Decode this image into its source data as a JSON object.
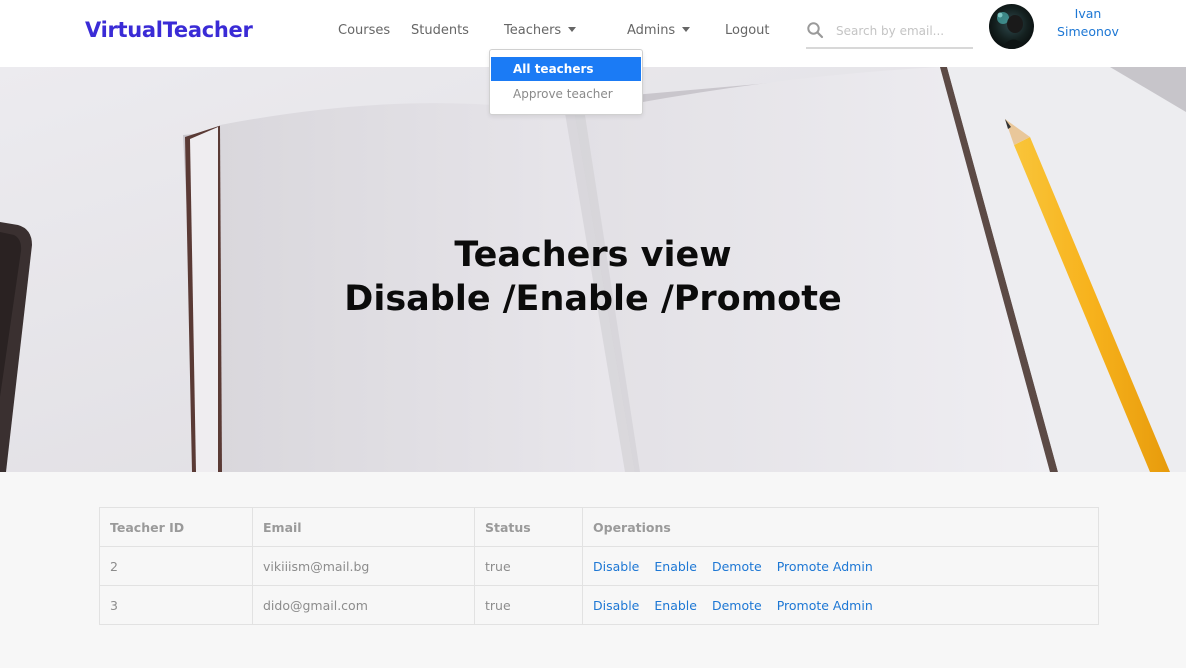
{
  "navbar": {
    "brand": "VirtualTeacher",
    "links": {
      "courses": "Courses",
      "students": "Students",
      "teachers": "Teachers",
      "admins": "Admins",
      "logout": "Logout"
    },
    "search": {
      "placeholder": "Search by email...",
      "value": ""
    },
    "user": {
      "first_name": "Ivan",
      "last_name": "Simeonov"
    }
  },
  "dropdown": {
    "items": [
      {
        "label": "All teachers",
        "active": true
      },
      {
        "label": "Approve teacher",
        "active": false
      }
    ]
  },
  "hero": {
    "line1": "Teachers view",
    "line2": "Disable /Enable /Promote"
  },
  "table": {
    "headers": [
      "Teacher ID",
      "Email",
      "Status",
      "Operations"
    ],
    "rows": [
      {
        "id": "2",
        "email": "vikiiism@mail.bg",
        "status": "true"
      },
      {
        "id": "3",
        "email": "dido@gmail.com",
        "status": "true"
      }
    ],
    "operations": [
      "Disable",
      "Enable",
      "Demote",
      "Promote Admin"
    ]
  },
  "colors": {
    "brand": "#3a2bd6",
    "link": "#1d77d4",
    "dropdown_active": "#1b7bf5",
    "pencil": "#f7b21c"
  }
}
